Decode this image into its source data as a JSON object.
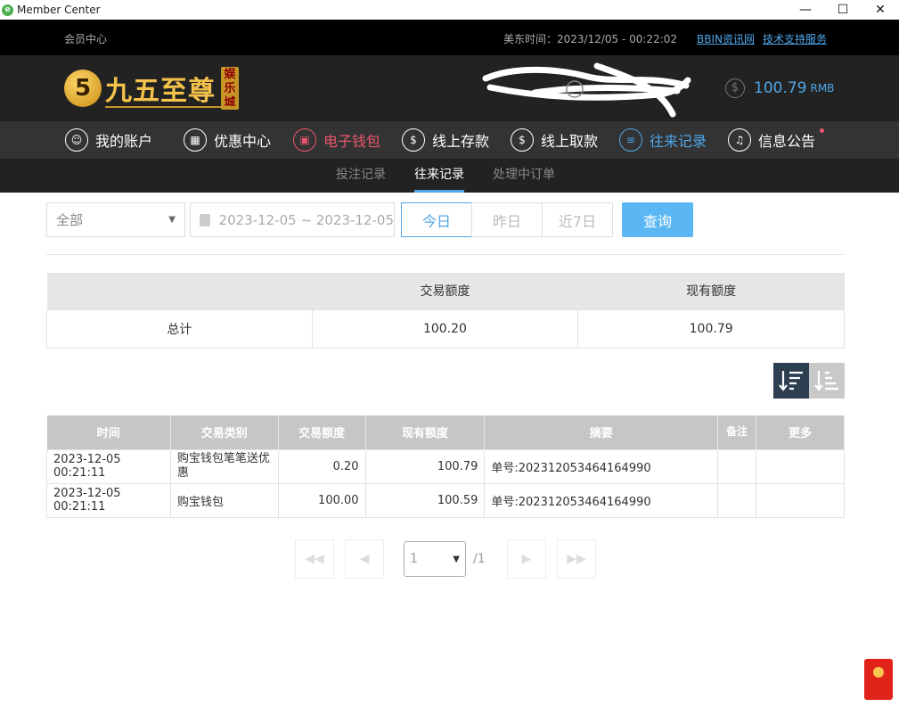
{
  "window": {
    "title": "Member Center",
    "minimize": "—",
    "maximize": "☐",
    "close": "✕"
  },
  "topbar": {
    "breadcrumb": "会员中心",
    "time": "美东时间：2023/12/05 - 00:22:02",
    "link_news": "BBIN资讯网",
    "link_support": "技术支持服务"
  },
  "header": {
    "logo_text": "九五至尊",
    "logo_badge": "娱乐城",
    "balance_amount": "100.79",
    "balance_unit": "RMB"
  },
  "nav": {
    "items": [
      {
        "label": "我的账户",
        "icon": "user-icon"
      },
      {
        "label": "优惠中心",
        "icon": "gift-icon"
      },
      {
        "label": "电子钱包",
        "icon": "wallet-icon"
      },
      {
        "label": "线上存款",
        "icon": "deposit-icon"
      },
      {
        "label": "线上取款",
        "icon": "withdraw-icon"
      },
      {
        "label": "往来记录",
        "icon": "record-icon"
      },
      {
        "label": "信息公告",
        "icon": "bell-icon"
      }
    ]
  },
  "subnav": {
    "tabs": [
      "投注记录",
      "往来记录",
      "处理中订单"
    ],
    "active": "往来记录"
  },
  "filter": {
    "type_value": "全部",
    "date_range": "2023-12-05 ~ 2023-12-05",
    "today": "今日",
    "yesterday": "昨日",
    "last7": "近7日",
    "query": "查询"
  },
  "summary": {
    "headers": [
      "",
      "交易额度",
      "现有额度"
    ],
    "row": [
      "总计",
      "100.20",
      "100.79"
    ]
  },
  "records": {
    "headers": [
      "时间",
      "交易类别",
      "交易额度",
      "现有额度",
      "摘要",
      "备注",
      "更多"
    ],
    "rows": [
      [
        "2023-12-05 00:21:11",
        "购宝钱包笔笔送优惠",
        "0.20",
        "100.79",
        "单号:2023120534641649 90",
        "",
        ""
      ],
      [
        "2023-12-05 00:21:11",
        "购宝钱包",
        "100.00",
        "100.59",
        "单号:202312053464164990",
        "",
        ""
      ]
    ]
  },
  "pager": {
    "current": "1",
    "total": "/1"
  }
}
